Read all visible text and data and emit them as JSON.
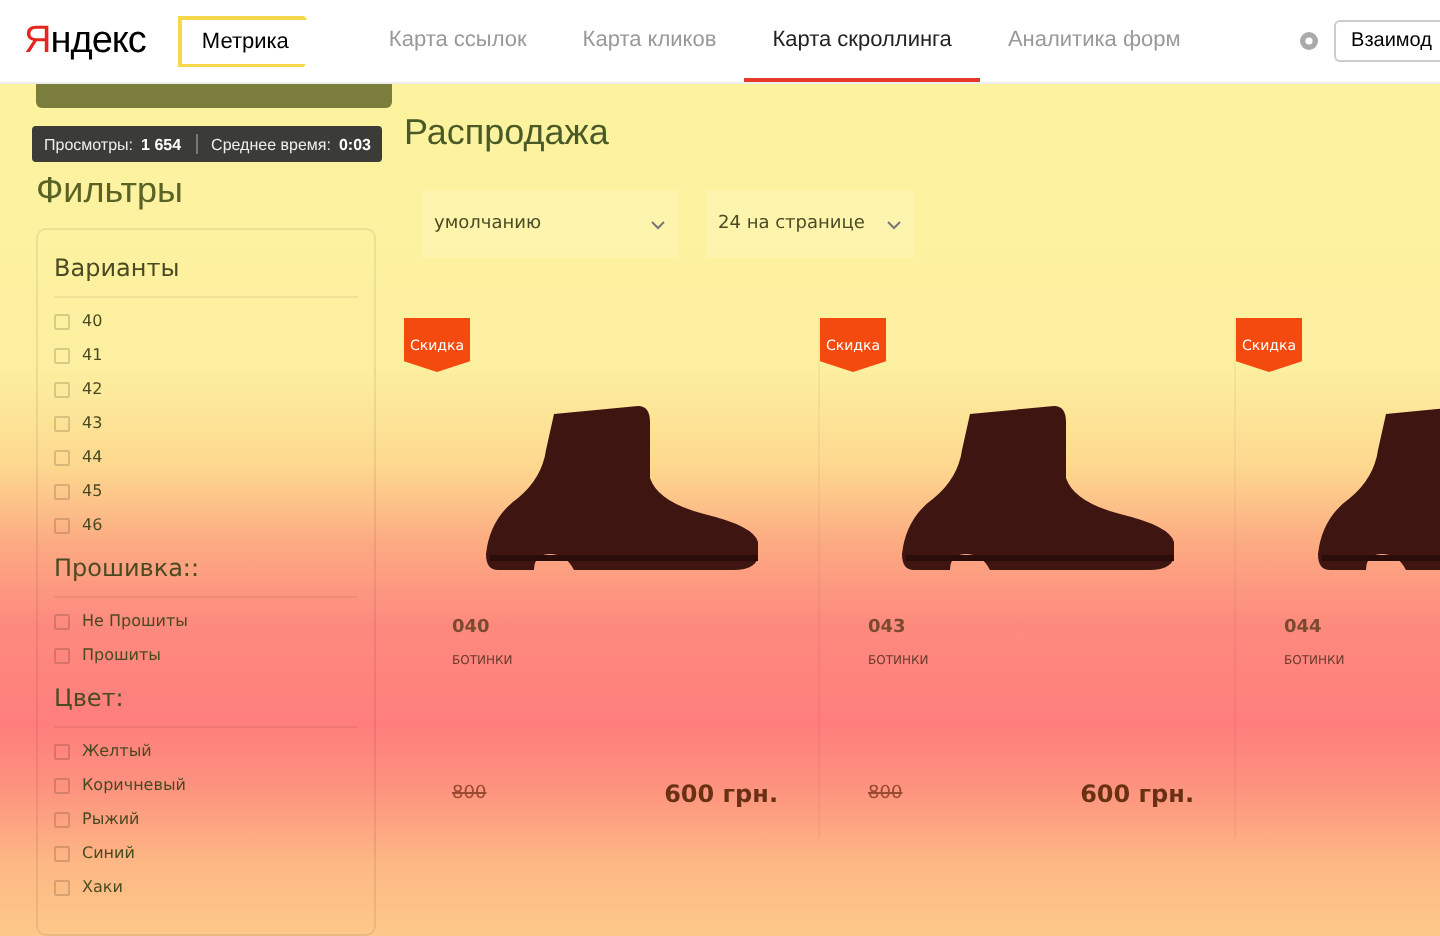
{
  "header": {
    "logo": "Яндекс",
    "product": "Метрика",
    "tabs": [
      {
        "label": "Карта ссылок",
        "selected": false
      },
      {
        "label": "Карта кликов",
        "selected": false
      },
      {
        "label": "Карта скроллинга",
        "selected": true
      },
      {
        "label": "Аналитика форм",
        "selected": false
      }
    ],
    "button": "Взаимод"
  },
  "stats": {
    "views_label": "Просмотры:",
    "views": "1 654",
    "time_label": "Среднее время:",
    "time": "0:03"
  },
  "filters": {
    "title": "Фильтры",
    "groups": [
      {
        "title": "Варианты",
        "options": [
          {
            "label": "40",
            "checked": false
          },
          {
            "label": "41",
            "checked": false
          },
          {
            "label": "42",
            "checked": false
          },
          {
            "label": "43",
            "checked": false
          },
          {
            "label": "44",
            "checked": false
          },
          {
            "label": "45",
            "checked": false
          },
          {
            "label": "46",
            "checked": false
          }
        ]
      },
      {
        "title": "Прошивка::",
        "options": [
          {
            "label": "Не Прошиты",
            "checked": false
          },
          {
            "label": "Прошиты",
            "checked": false
          }
        ]
      },
      {
        "title": "Цвет:",
        "options": [
          {
            "label": "Желтый",
            "checked": false
          },
          {
            "label": "Коричневый",
            "checked": false
          },
          {
            "label": "Рыжий",
            "checked": false
          },
          {
            "label": "Синий",
            "checked": false
          },
          {
            "label": "Хаки",
            "checked": false
          }
        ]
      }
    ]
  },
  "catalog": {
    "title": "Распродажа",
    "sort": "умолчанию",
    "per_page": "24 на странице",
    "products": [
      {
        "badge": "Скидка",
        "code": "040",
        "category": "БОТИНКИ",
        "old_price": "800",
        "price": "600 грн."
      },
      {
        "badge": "Скидка",
        "code": "043",
        "category": "БОТИНКИ",
        "old_price": "800",
        "price": "600 грн."
      },
      {
        "badge": "Скидка",
        "code": "044",
        "category": "БОТИНКИ"
      }
    ]
  }
}
